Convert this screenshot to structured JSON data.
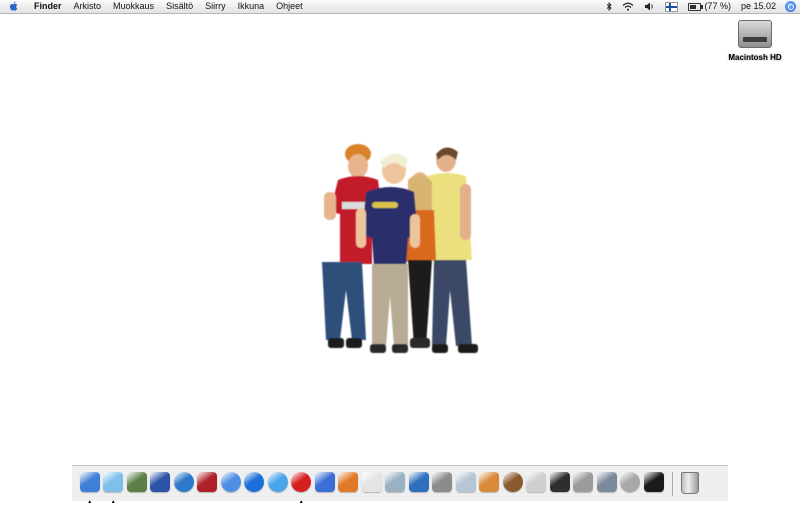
{
  "menubar": {
    "app_name": "Finder",
    "items": [
      "Arkisto",
      "Muokkaus",
      "Sisältö",
      "Siirry",
      "Ikkuna",
      "Ohjeet"
    ],
    "battery_text": "(77 %)",
    "battery_level": 0.77,
    "clock": "pe 15.02"
  },
  "desktop": {
    "disk_label": "Macintosh HD"
  },
  "dock": {
    "apps": [
      {
        "name": "finder-icon",
        "color": "#3f7fd8",
        "running": true
      },
      {
        "name": "itunes-icon",
        "color": "#7fc0ea",
        "running": true
      },
      {
        "name": "iphoto-icon",
        "color": "#5c7f47",
        "running": false
      },
      {
        "name": "imovie-icon",
        "color": "#2b53a8",
        "running": false
      },
      {
        "name": "idvd-icon",
        "color": "#2c78c9",
        "running": false
      },
      {
        "name": "dvd-player-icon",
        "color": "#b0202a",
        "running": false
      },
      {
        "name": "safari-icon",
        "color": "#4f8fe3",
        "running": false
      },
      {
        "name": "quicktime-icon",
        "color": "#1d6ed9",
        "running": false
      },
      {
        "name": "msn-messenger-icon",
        "color": "#4aa4e8",
        "running": false
      },
      {
        "name": "opera-icon",
        "color": "#d61f1f",
        "running": true
      },
      {
        "name": "word-icon",
        "color": "#3c6fd6",
        "running": false
      },
      {
        "name": "powerpoint-icon",
        "color": "#e07a2a",
        "running": false
      },
      {
        "name": "textedit-icon",
        "color": "#e4e4e4",
        "running": false
      },
      {
        "name": "applications-icon",
        "color": "#9ab1c4",
        "running": false
      },
      {
        "name": "system-profiler-icon",
        "color": "#2e6fbf",
        "running": false
      },
      {
        "name": "image-capture-icon",
        "color": "#8c8c8c",
        "running": false
      },
      {
        "name": "airport-icon",
        "color": "#b7c6d4",
        "running": false
      },
      {
        "name": "color-sync-icon",
        "color": "#d88a3a",
        "running": false
      },
      {
        "name": "coconut-battery-icon",
        "color": "#8a5a2e",
        "running": false
      },
      {
        "name": "script-editor-icon",
        "color": "#cfcfcf",
        "running": false
      },
      {
        "name": "activity-monitor-icon",
        "color": "#2e2e2e",
        "running": false
      },
      {
        "name": "system-preferences-icon",
        "color": "#9b9b9b",
        "running": false
      },
      {
        "name": "printer-setup-icon",
        "color": "#7a8a9a",
        "running": false
      },
      {
        "name": "disk-utility-icon",
        "color": "#a8a8a8",
        "running": false
      },
      {
        "name": "terminal-icon",
        "color": "#1a1a1a",
        "running": false
      }
    ],
    "trash": "trash-icon"
  }
}
